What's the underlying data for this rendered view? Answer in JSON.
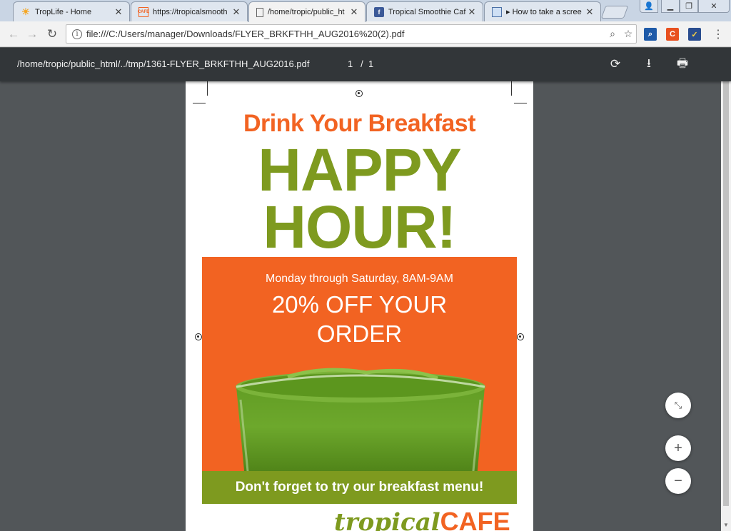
{
  "tabs": [
    {
      "title": "TropLife - Home",
      "favicon": "sun-icon",
      "active": false
    },
    {
      "title": "https://tropicalsmooth",
      "favicon": "cafe-icon",
      "active": false
    },
    {
      "title": "/home/tropic/public_ht",
      "favicon": "page-icon",
      "active": true
    },
    {
      "title": "Tropical Smoothie Caf",
      "favicon": "facebook-icon",
      "active": false
    },
    {
      "title": "▸ How to take a scree",
      "favicon": "screenshot-icon",
      "active": false
    }
  ],
  "address_bar": {
    "url": "file:///C:/Users/manager/Downloads/FLYER_BRKFTHH_AUG2016%20(2).pdf"
  },
  "pdf_toolbar": {
    "filename": "/home/tropic/public_html/../tmp/1361-FLYER_BRKFTHH_AUG2016.pdf",
    "current_page": "1",
    "separator": "/",
    "total_pages": "1"
  },
  "flyer": {
    "headline": "Drink Your Breakfast",
    "happy": "HAPPY",
    "hour": "HOUR!",
    "days": "Monday through Saturday, 8AM-9AM",
    "offer_line1": "20% OFF YOUR",
    "offer_line2": "ORDER",
    "footer_banner": "Don't forget to try our breakfast menu!",
    "logo_tropical": "tropical",
    "logo_cafe": "CAFE"
  },
  "colors": {
    "orange": "#f26322",
    "green": "#7e9a1f",
    "pdf_toolbar": "#323639",
    "viewer_bg": "#525659"
  }
}
